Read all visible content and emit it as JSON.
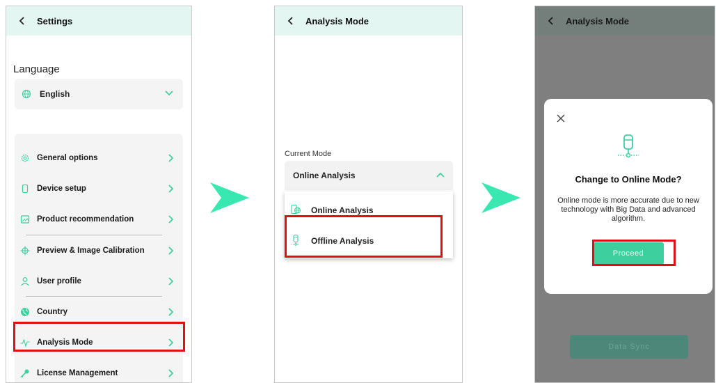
{
  "colors": {
    "topbar": "#e3f6f1",
    "accent": "#3ecf9e",
    "highlight": "#e01010",
    "arrow": "#39e7b1"
  },
  "panel1": {
    "title": "Settings",
    "language_heading": "Language",
    "language_value": "English",
    "menu": [
      {
        "label": "General options",
        "icon": "gear-icon"
      },
      {
        "label": "Device setup",
        "icon": "device-icon"
      },
      {
        "label": "Product recommendation",
        "icon": "image-icon"
      },
      {
        "label": "Preview & Image Calibration",
        "icon": "calibration-icon"
      },
      {
        "label": "User profile",
        "icon": "user-icon"
      },
      {
        "label": "Country",
        "icon": "globe-icon"
      },
      {
        "label": "Analysis Mode",
        "icon": "pulse-icon"
      },
      {
        "label": "License Management",
        "icon": "key-icon"
      }
    ]
  },
  "panel2": {
    "title": "Analysis Mode",
    "current_mode_label": "Current Mode",
    "selected_value": "Online Analysis",
    "options": [
      {
        "label": "Online Analysis",
        "icon": "online-analysis-icon"
      },
      {
        "label": "Offline Analysis",
        "icon": "offline-analysis-icon"
      }
    ]
  },
  "panel3": {
    "title": "Analysis Mode",
    "dialog_title": "Change to Online Mode?",
    "dialog_body": "Online mode is more accurate due to new technology with Big Data and advanced algorithm.",
    "proceed_label": "Proceed",
    "data_sync_label": "Data Sync"
  }
}
